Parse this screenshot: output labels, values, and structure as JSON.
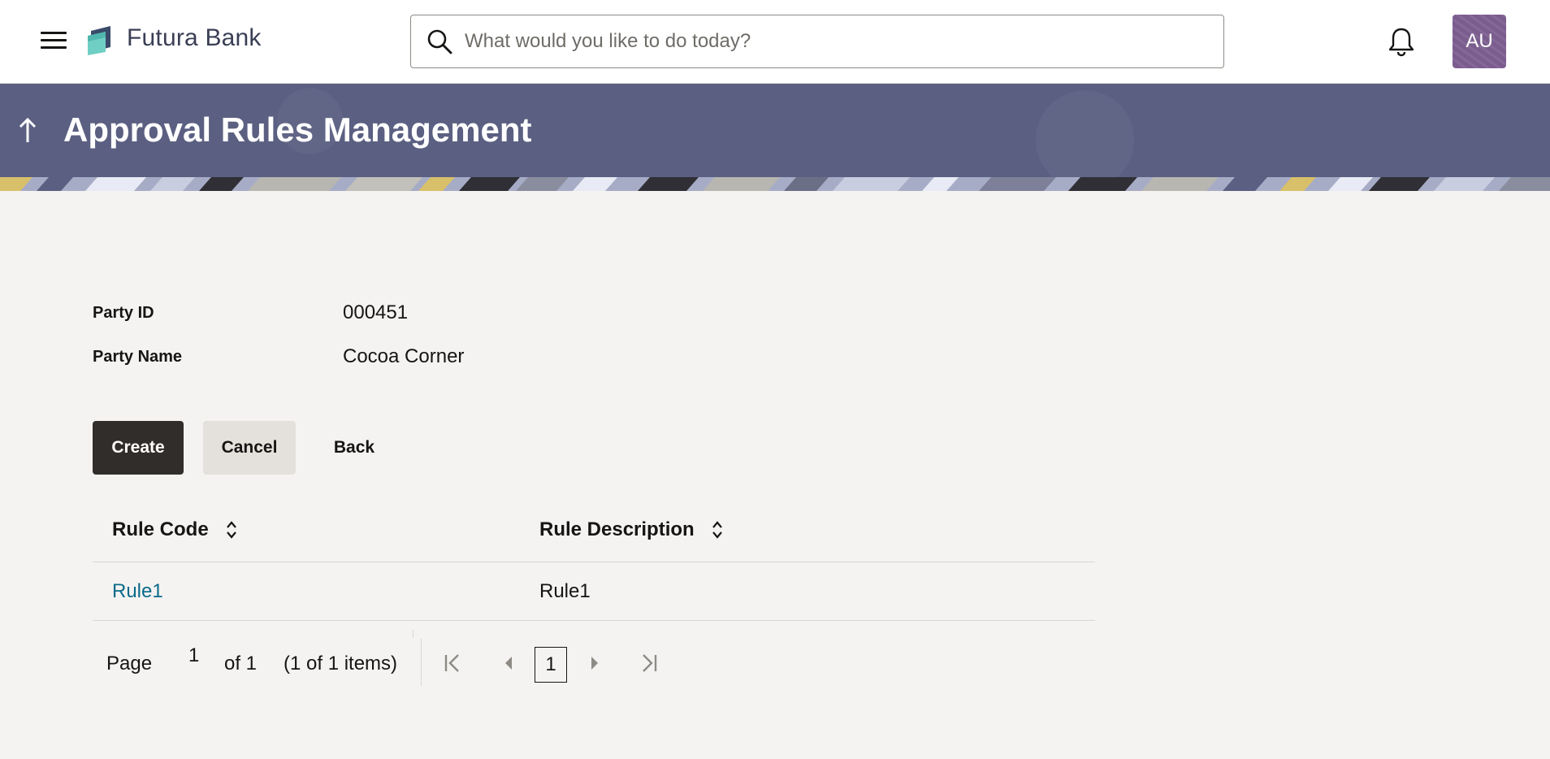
{
  "app": {
    "brand": "Futura Bank",
    "avatar_initials": "AU"
  },
  "search": {
    "placeholder": "What would you like to do today?",
    "value": ""
  },
  "header": {
    "title": "Approval Rules Management"
  },
  "party": {
    "id_label": "Party ID",
    "id_value": "000451",
    "name_label": "Party Name",
    "name_value": "Cocoa Corner"
  },
  "actions": {
    "create": "Create",
    "cancel": "Cancel",
    "back": "Back"
  },
  "table": {
    "columns": [
      "Rule Code",
      "Rule Description"
    ],
    "rows": [
      {
        "code": "Rule1",
        "description": "Rule1"
      }
    ]
  },
  "pagination": {
    "page_label": "Page",
    "page_input": "1",
    "of_label": "of 1",
    "items_label": "(1 of 1 items)",
    "current_page": "1"
  },
  "colors": {
    "header_band": "#5b6082",
    "primary_button": "#312d2a",
    "link": "#0a6a8a",
    "avatar": "#7a5c8e"
  },
  "icons": [
    "hamburger-icon",
    "futura-bank-logo",
    "search-icon",
    "bell-icon",
    "back-arrow-icon",
    "sort-icon",
    "first-page-icon",
    "prev-page-icon",
    "next-page-icon",
    "last-page-icon"
  ]
}
